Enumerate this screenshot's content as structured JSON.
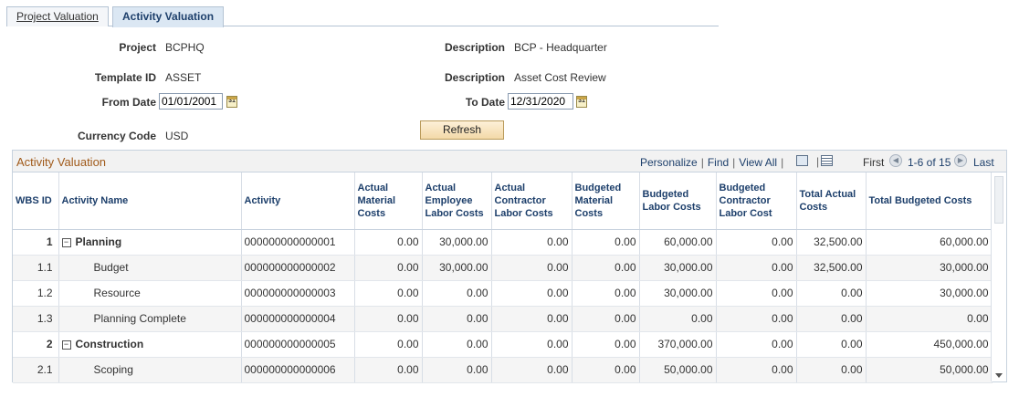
{
  "tabs": [
    {
      "label": "Project Valuation",
      "active": false
    },
    {
      "label": "Activity Valuation",
      "active": true
    }
  ],
  "form": {
    "project_label": "Project",
    "project_value": "BCPHQ",
    "description1_label": "Description",
    "description1_value": "BCP - Headquarter",
    "template_label": "Template ID",
    "template_value": "ASSET",
    "description2_label": "Description",
    "description2_value": "Asset Cost Review",
    "from_date_label": "From Date",
    "from_date_value": "01/01/2001",
    "to_date_label": "To Date",
    "to_date_value": "12/31/2020",
    "currency_label": "Currency Code",
    "currency_value": "USD",
    "refresh_label": "Refresh",
    "calendar_icon_text": "31"
  },
  "grid": {
    "title": "Activity Valuation",
    "personalize": "Personalize",
    "find": "Find",
    "view_all": "View All",
    "first": "First",
    "range": "1-6 of 15",
    "last": "Last",
    "columns": [
      "WBS ID",
      "Activity Name",
      "Activity",
      "Actual Material Costs",
      "Actual Employee Labor Costs",
      "Actual Contractor Labor Costs",
      "Budgeted Material Costs",
      "Budgeted Labor Costs",
      "Budgeted Contractor Labor Cost",
      "Total Actual Costs",
      "Total Budgeted Costs"
    ],
    "rows": [
      {
        "wbs": "1",
        "name": "Planning",
        "activity": "000000000000001",
        "amc": "0.00",
        "aelc": "30,000.00",
        "aclc": "0.00",
        "bmc": "0.00",
        "blc": "60,000.00",
        "bclc": "0.00",
        "tac": "32,500.00",
        "tbc": "60,000.00"
      },
      {
        "wbs": "1.1",
        "name": "Budget",
        "activity": "000000000000002",
        "amc": "0.00",
        "aelc": "30,000.00",
        "aclc": "0.00",
        "bmc": "0.00",
        "blc": "30,000.00",
        "bclc": "0.00",
        "tac": "32,500.00",
        "tbc": "30,000.00"
      },
      {
        "wbs": "1.2",
        "name": "Resource",
        "activity": "000000000000003",
        "amc": "0.00",
        "aelc": "0.00",
        "aclc": "0.00",
        "bmc": "0.00",
        "blc": "30,000.00",
        "bclc": "0.00",
        "tac": "0.00",
        "tbc": "30,000.00"
      },
      {
        "wbs": "1.3",
        "name": "Planning Complete",
        "activity": "000000000000004",
        "amc": "0.00",
        "aelc": "0.00",
        "aclc": "0.00",
        "bmc": "0.00",
        "blc": "0.00",
        "bclc": "0.00",
        "tac": "0.00",
        "tbc": "0.00"
      },
      {
        "wbs": "2",
        "name": "Construction",
        "activity": "000000000000005",
        "amc": "0.00",
        "aelc": "0.00",
        "aclc": "0.00",
        "bmc": "0.00",
        "blc": "370,000.00",
        "bclc": "0.00",
        "tac": "0.00",
        "tbc": "450,000.00"
      },
      {
        "wbs": "2.1",
        "name": "Scoping",
        "activity": "000000000000006",
        "amc": "0.00",
        "aelc": "0.00",
        "aclc": "0.00",
        "bmc": "0.00",
        "blc": "50,000.00",
        "bclc": "0.00",
        "tac": "0.00",
        "tbc": "50,000.00"
      }
    ],
    "collapse_symbol": "−"
  }
}
